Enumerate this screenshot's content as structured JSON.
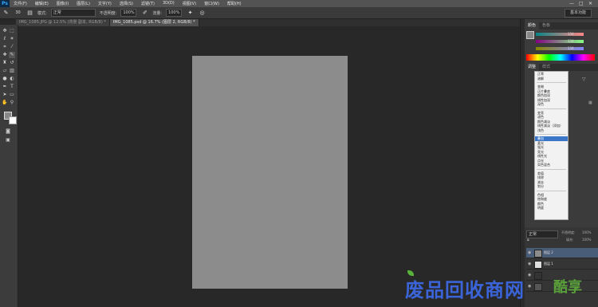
{
  "menubar": {
    "logo": "Ps",
    "items": [
      "文件(F)",
      "编辑(E)",
      "图像(I)",
      "图层(L)",
      "文字(Y)",
      "选择(S)",
      "滤镜(T)",
      "3D(D)",
      "视图(V)",
      "窗口(W)",
      "帮助(H)"
    ],
    "window_controls": [
      "—",
      "□",
      "✕"
    ]
  },
  "options": {
    "mode_label": "模式:",
    "mode_value": "正常",
    "opacity_label": "不透明度:",
    "opacity_value": "100%",
    "flow_label": "流量:",
    "flow_value": "100%",
    "brush_size": "30",
    "workspace": "基本功能"
  },
  "tabs": [
    {
      "label": "IMG_1085.JPG @ 12.5% (背景 副本, RGB/8) *",
      "active": false
    },
    {
      "label": "IMG_1085.psd @ 16.7% (图层 2, RGB/8) *",
      "active": true
    }
  ],
  "color_panel": {
    "tabs": [
      "颜色",
      "色板"
    ],
    "r": "134",
    "g": "134",
    "b": "134"
  },
  "adjust_tabs": [
    "调整",
    "样式"
  ],
  "blend_menu": {
    "groups": [
      [
        "正常",
        "溶解"
      ],
      [
        "变暗",
        "正片叠底",
        "颜色加深",
        "线性加深",
        "深色"
      ],
      [
        "变亮",
        "滤色",
        "颜色减淡",
        "线性减淡（添加）",
        "浅色"
      ],
      [
        "叠加",
        "柔光",
        "强光",
        "亮光",
        "线性光",
        "点光",
        "实色混合"
      ],
      [
        "差值",
        "排除",
        "减去",
        "划分"
      ],
      [
        "色相",
        "饱和度",
        "颜色",
        "明度"
      ]
    ],
    "selected": "叠加"
  },
  "layers_panel": {
    "blend_value": "正常",
    "opacity_label": "不透明度:",
    "opacity_value": "100%",
    "fill_label": "填充:",
    "fill_value": "100%",
    "layers": [
      "图层 2",
      "图层 1"
    ]
  },
  "watermark": {
    "text": "废品回收商网",
    "ext": "酷享"
  },
  "colors": {
    "canvas": "#8c8c8c",
    "watermark": "#3a64d8",
    "selection": "#3b77c8"
  }
}
